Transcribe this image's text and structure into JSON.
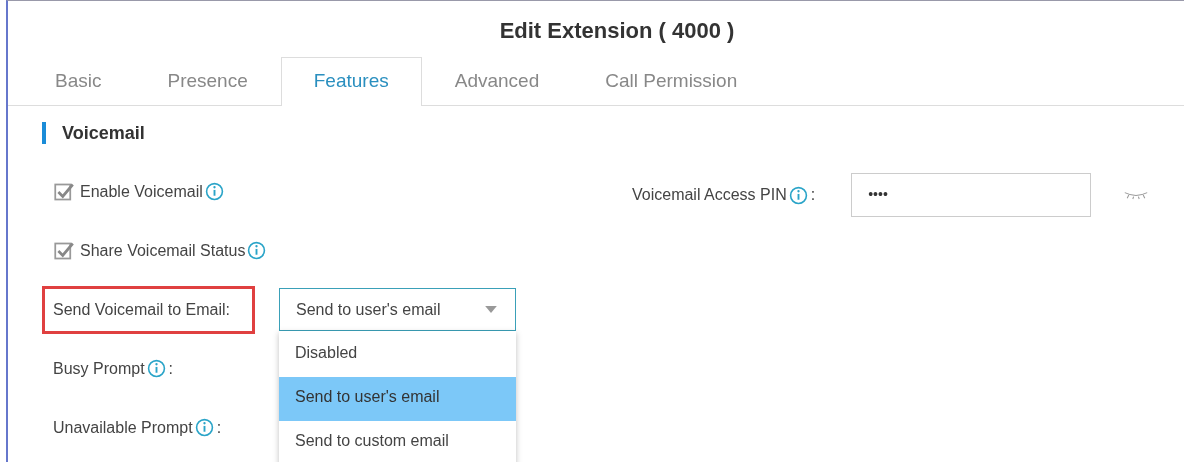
{
  "dialog": {
    "title": "Edit Extension ( 4000 )"
  },
  "tabs": [
    {
      "label": "Basic",
      "selected": false
    },
    {
      "label": "Presence",
      "selected": false
    },
    {
      "label": "Features",
      "selected": true
    },
    {
      "label": "Advanced",
      "selected": false
    },
    {
      "label": "Call Permission",
      "selected": false
    }
  ],
  "section": {
    "title": "Voicemail"
  },
  "fields": [
    {
      "kind": "checkbox",
      "label": "Enable Voicemail",
      "checked": true,
      "info": true
    },
    {
      "kind": "checkbox",
      "label": "Share Voicemail Status",
      "checked": true,
      "info": true
    },
    {
      "kind": "select",
      "label": "Send Voicemail to Email:",
      "highlighted": true,
      "value": "Send to user's email",
      "expanded": true,
      "options": [
        {
          "label": "Disabled",
          "selected": false
        },
        {
          "label": "Send to user's email",
          "selected": true
        },
        {
          "label": "Send to custom email",
          "selected": false
        }
      ]
    },
    {
      "kind": "label",
      "label": "Busy Prompt",
      "info": true,
      "suffix": ":"
    },
    {
      "kind": "label",
      "label": "Unavailable Prompt",
      "info": true,
      "suffix": ":"
    }
  ],
  "pin": {
    "label": "Voicemail Access PIN",
    "suffix": ":",
    "value": "••••"
  }
}
